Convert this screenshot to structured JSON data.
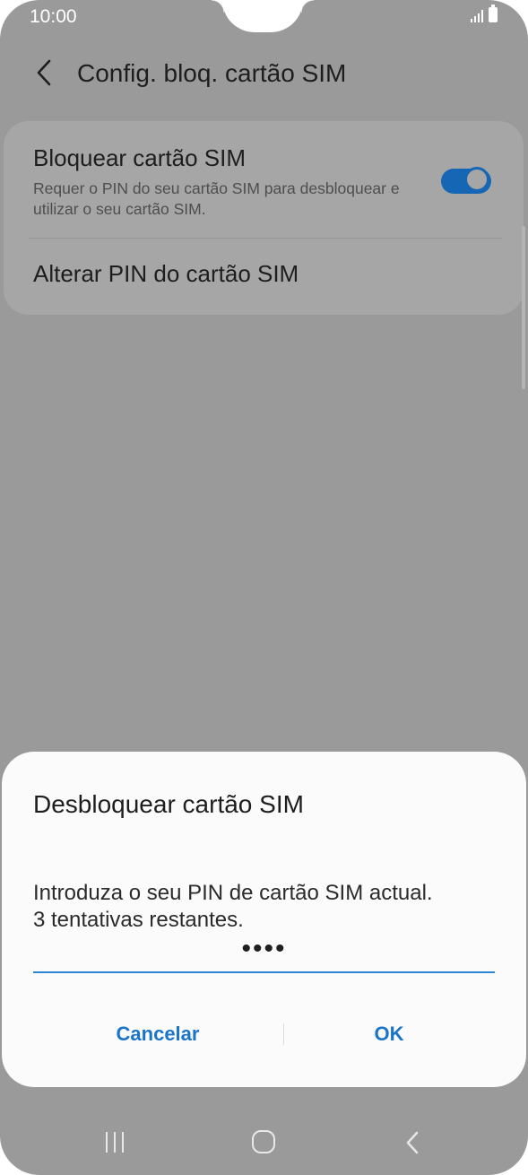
{
  "status_bar": {
    "time": "10:00",
    "signal_icon": "signal-icon",
    "battery_icon": "battery-icon"
  },
  "header": {
    "back_icon": "chevron-left-icon",
    "title": "Config. bloq. cartão SIM"
  },
  "settings": {
    "lock_sim": {
      "title": "Bloquear cartão SIM",
      "subtitle": "Requer o PIN do seu cartão SIM para desbloquear e utilizar o seu cartão SIM.",
      "enabled": true
    },
    "change_pin": {
      "title": "Alterar PIN do cartão SIM"
    }
  },
  "dialog": {
    "title": "Desbloquear cartão SIM",
    "message_line1": "Introduza o seu PIN de cartão SIM actual.",
    "message_line2": "3 tentativas restantes.",
    "pin_value": "••••",
    "cancel_label": "Cancelar",
    "ok_label": "OK"
  },
  "nav_bar": {
    "recents_icon": "recents-icon",
    "home_icon": "home-icon",
    "back_icon": "back-icon"
  },
  "colors": {
    "accent": "#1566b4",
    "dialog_button": "#1b74c7",
    "scrim": "#9a9a9a",
    "dialog_bg": "#fbfbfb"
  }
}
